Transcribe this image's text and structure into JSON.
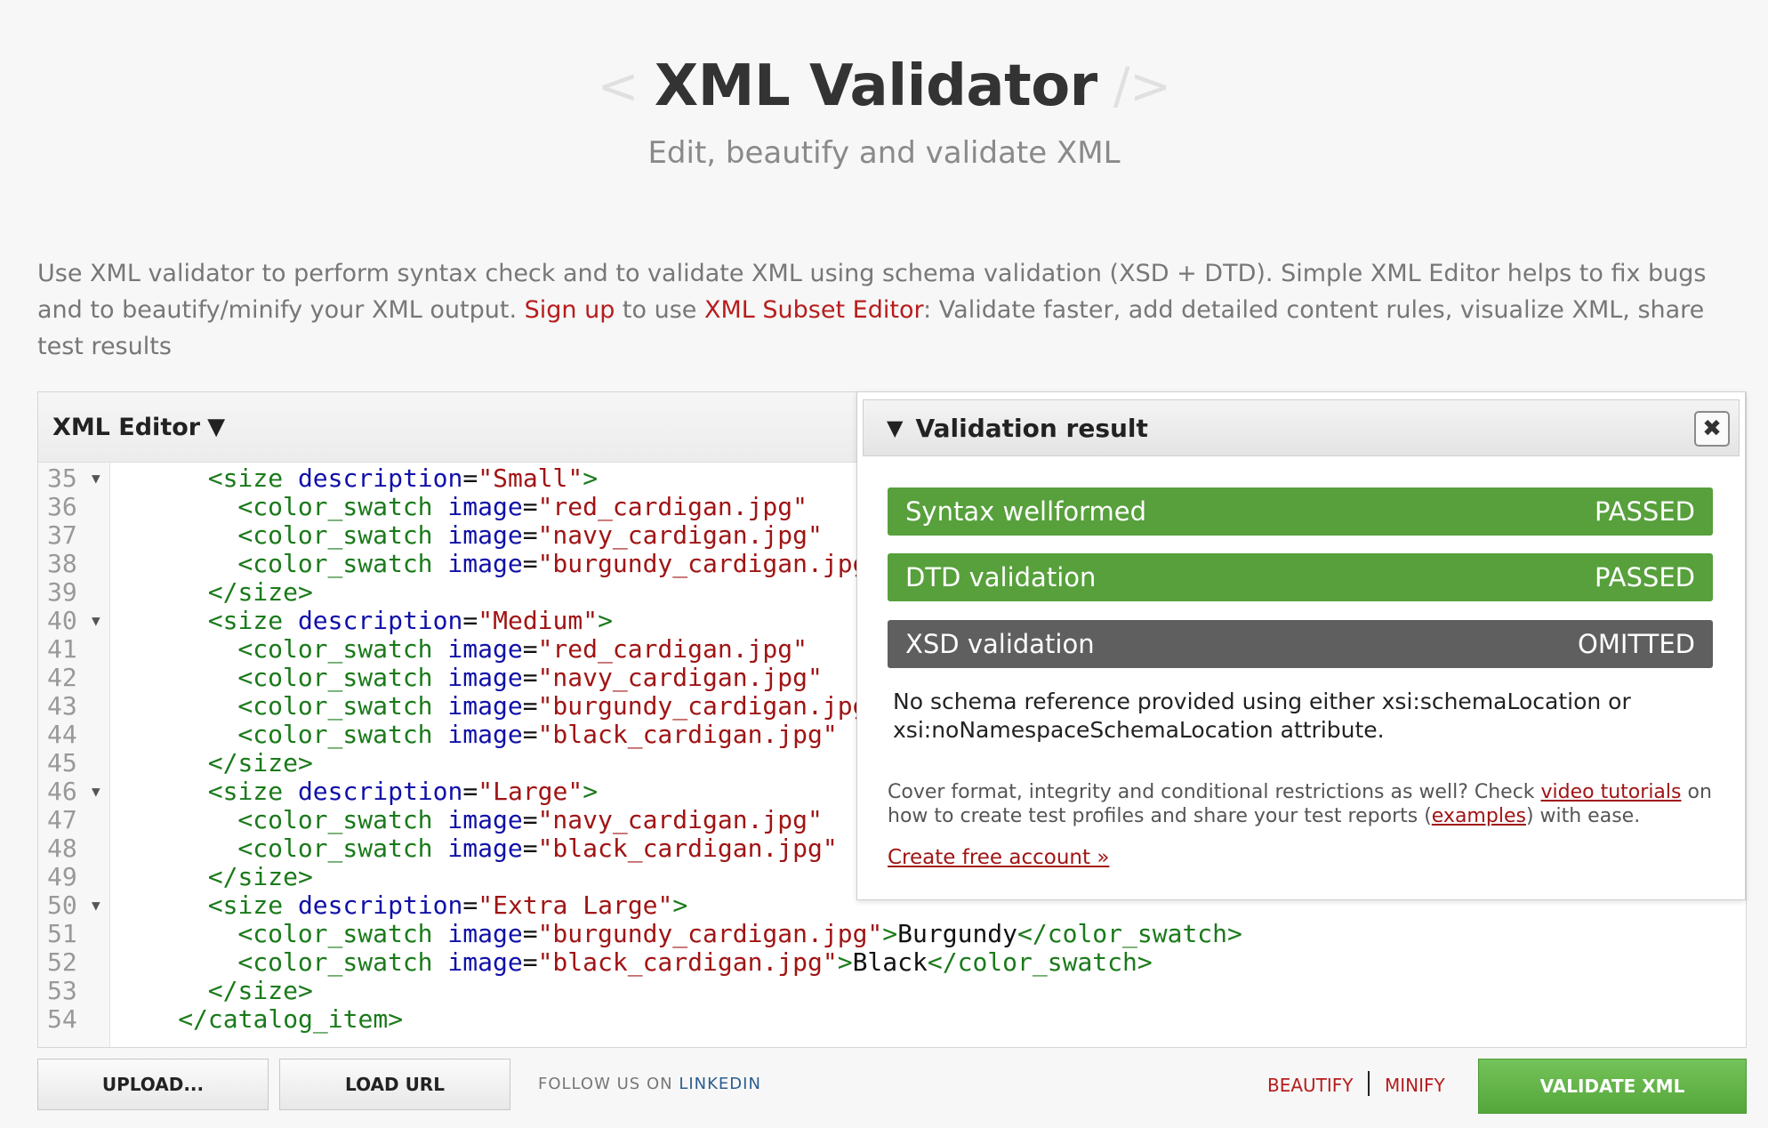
{
  "header": {
    "open_bracket": "<",
    "title": "XML Validator",
    "close_bracket": "/>",
    "subtitle": "Edit, beautify and validate XML"
  },
  "intro": {
    "text1": "Use XML validator to perform syntax check and to validate XML using schema validation (XSD + DTD). Simple XML Editor helps to fix bugs and to beautify/minify your XML output. ",
    "signup": "Sign up",
    "text2": " to use ",
    "subset_editor": "XML Subset Editor",
    "text3": ": Validate faster, add detailed content rules, visualize XML, share test results"
  },
  "editor": {
    "title": "XML Editor",
    "toggle": "▼",
    "lines": [
      {
        "n": "35",
        "fold": true,
        "ind": 3,
        "parts": [
          [
            "t",
            "<size "
          ],
          [
            "a",
            "description"
          ],
          [
            "x",
            "="
          ],
          [
            "v",
            "\"Small\""
          ],
          [
            "t",
            ">"
          ]
        ]
      },
      {
        "n": "36",
        "fold": false,
        "ind": 4,
        "parts": [
          [
            "t",
            "<color_swatch "
          ],
          [
            "a",
            "image"
          ],
          [
            "x",
            "="
          ],
          [
            "v",
            "\"red_cardigan.jpg\""
          ]
        ]
      },
      {
        "n": "37",
        "fold": false,
        "ind": 4,
        "parts": [
          [
            "t",
            "<color_swatch "
          ],
          [
            "a",
            "image"
          ],
          [
            "x",
            "="
          ],
          [
            "v",
            "\"navy_cardigan.jpg\""
          ]
        ]
      },
      {
        "n": "38",
        "fold": false,
        "ind": 4,
        "parts": [
          [
            "t",
            "<color_swatch "
          ],
          [
            "a",
            "image"
          ],
          [
            "x",
            "="
          ],
          [
            "v",
            "\"burgundy_cardigan.jpg\""
          ]
        ]
      },
      {
        "n": "39",
        "fold": false,
        "ind": 3,
        "parts": [
          [
            "t",
            "</size>"
          ]
        ]
      },
      {
        "n": "40",
        "fold": true,
        "ind": 3,
        "parts": [
          [
            "t",
            "<size "
          ],
          [
            "a",
            "description"
          ],
          [
            "x",
            "="
          ],
          [
            "v",
            "\"Medium\""
          ],
          [
            "t",
            ">"
          ]
        ]
      },
      {
        "n": "41",
        "fold": false,
        "ind": 4,
        "parts": [
          [
            "t",
            "<color_swatch "
          ],
          [
            "a",
            "image"
          ],
          [
            "x",
            "="
          ],
          [
            "v",
            "\"red_cardigan.jpg\""
          ]
        ]
      },
      {
        "n": "42",
        "fold": false,
        "ind": 4,
        "parts": [
          [
            "t",
            "<color_swatch "
          ],
          [
            "a",
            "image"
          ],
          [
            "x",
            "="
          ],
          [
            "v",
            "\"navy_cardigan.jpg\""
          ]
        ]
      },
      {
        "n": "43",
        "fold": false,
        "ind": 4,
        "parts": [
          [
            "t",
            "<color_swatch "
          ],
          [
            "a",
            "image"
          ],
          [
            "x",
            "="
          ],
          [
            "v",
            "\"burgundy_cardigan.jpg\""
          ]
        ]
      },
      {
        "n": "44",
        "fold": false,
        "ind": 4,
        "parts": [
          [
            "t",
            "<color_swatch "
          ],
          [
            "a",
            "image"
          ],
          [
            "x",
            "="
          ],
          [
            "v",
            "\"black_cardigan.jpg\""
          ]
        ]
      },
      {
        "n": "45",
        "fold": false,
        "ind": 3,
        "parts": [
          [
            "t",
            "</size>"
          ]
        ]
      },
      {
        "n": "46",
        "fold": true,
        "ind": 3,
        "parts": [
          [
            "t",
            "<size "
          ],
          [
            "a",
            "description"
          ],
          [
            "x",
            "="
          ],
          [
            "v",
            "\"Large\""
          ],
          [
            "t",
            ">"
          ]
        ]
      },
      {
        "n": "47",
        "fold": false,
        "ind": 4,
        "parts": [
          [
            "t",
            "<color_swatch "
          ],
          [
            "a",
            "image"
          ],
          [
            "x",
            "="
          ],
          [
            "v",
            "\"navy_cardigan.jpg\""
          ]
        ]
      },
      {
        "n": "48",
        "fold": false,
        "ind": 4,
        "parts": [
          [
            "t",
            "<color_swatch "
          ],
          [
            "a",
            "image"
          ],
          [
            "x",
            "="
          ],
          [
            "v",
            "\"black_cardigan.jpg\""
          ]
        ]
      },
      {
        "n": "49",
        "fold": false,
        "ind": 3,
        "parts": [
          [
            "t",
            "</size>"
          ]
        ]
      },
      {
        "n": "50",
        "fold": true,
        "ind": 3,
        "parts": [
          [
            "t",
            "<size "
          ],
          [
            "a",
            "description"
          ],
          [
            "x",
            "="
          ],
          [
            "v",
            "\"Extra Large\""
          ],
          [
            "t",
            ">"
          ]
        ]
      },
      {
        "n": "51",
        "fold": false,
        "ind": 4,
        "parts": [
          [
            "t",
            "<color_swatch "
          ],
          [
            "a",
            "image"
          ],
          [
            "x",
            "="
          ],
          [
            "v",
            "\"burgundy_cardigan.jpg\""
          ],
          [
            "t",
            ">"
          ],
          [
            "x",
            "Burgundy"
          ],
          [
            "t",
            "</color_swatch>"
          ]
        ]
      },
      {
        "n": "52",
        "fold": false,
        "ind": 4,
        "parts": [
          [
            "t",
            "<color_swatch "
          ],
          [
            "a",
            "image"
          ],
          [
            "x",
            "="
          ],
          [
            "v",
            "\"black_cardigan.jpg\""
          ],
          [
            "t",
            ">"
          ],
          [
            "x",
            "Black"
          ],
          [
            "t",
            "</color_swatch>"
          ]
        ]
      },
      {
        "n": "53",
        "fold": false,
        "ind": 3,
        "parts": [
          [
            "t",
            "</size>"
          ]
        ]
      },
      {
        "n": "54",
        "fold": false,
        "ind": 2,
        "parts": [
          [
            "t",
            "</catalog_item>"
          ]
        ]
      }
    ]
  },
  "validation": {
    "title": "Validation result",
    "toggle": "▼",
    "close_symbol": "✖",
    "rows": [
      {
        "label": "Syntax wellformed",
        "status": "PASSED"
      },
      {
        "label": "DTD validation",
        "status": "PASSED"
      },
      {
        "label": "XSD validation",
        "status": "OMITTED"
      }
    ],
    "message": "No schema reference provided using either xsi:schemaLocation or xsi:noNamespaceSchemaLocation attribute.",
    "note_text1": "Cover format, integrity and conditional restrictions as well? Check ",
    "note_link1": "video tutorials",
    "note_text2": " on how to create test profiles and share your test reports (",
    "note_link2": "examples",
    "note_text3": ") with ease.",
    "create_account": "Create free account »"
  },
  "footer": {
    "upload": "UPLOAD...",
    "load_url": "LOAD URL",
    "follow": "FOLLOW US ON ",
    "linkedin": "LINKEDIN",
    "beautify": "BEAUTIFY",
    "minify": "MINIFY",
    "validate": "VALIDATE XML"
  },
  "colors": {
    "passed": "#57a03c",
    "omitted": "#5f5f5f",
    "link_red": "#b71c1c",
    "validate_green": "#5cb043"
  }
}
